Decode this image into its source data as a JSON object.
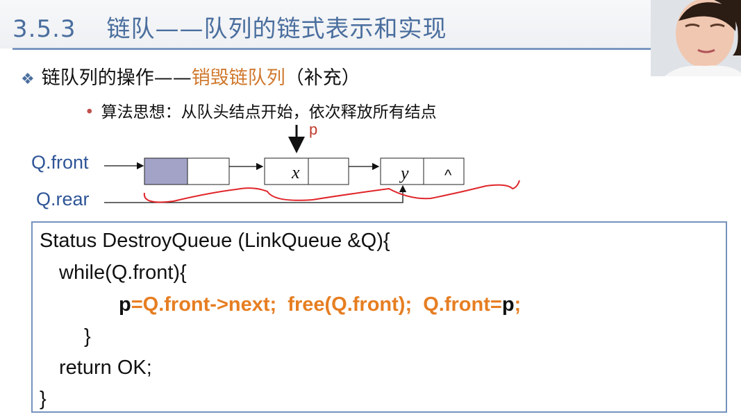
{
  "title": {
    "number": "3.5.3",
    "text": "链队——队列的链式表示和实现"
  },
  "bullet": {
    "prefix": "链队列的操作——",
    "highlight": "销毁链队列",
    "suffix": "（补充）"
  },
  "subbullet": "算法思想：从队头结点开始，依次释放所有结点",
  "diagram": {
    "pointer_label": "p",
    "front_label": "Q.front",
    "rear_label": "Q.rear",
    "node_values": [
      "",
      "x",
      "y"
    ],
    "null_symbol": "^"
  },
  "code": {
    "line1": "Status DestroyQueue (LinkQueue &Q){",
    "line2": "while(Q.front){",
    "line3": {
      "p1": "p",
      "mid": "=Q.front->next;  free(Q.front);  Q.front=",
      "p2": "p",
      "end": ";"
    },
    "line4": "}",
    "line5": "return OK;",
    "line6": "}"
  },
  "colors": {
    "title": "#4a6e9e",
    "highlight": "#d0782d",
    "code_highlight": "#e67e22",
    "annotation": "#e0252a",
    "head_node_fill": "#a3a3c8"
  }
}
